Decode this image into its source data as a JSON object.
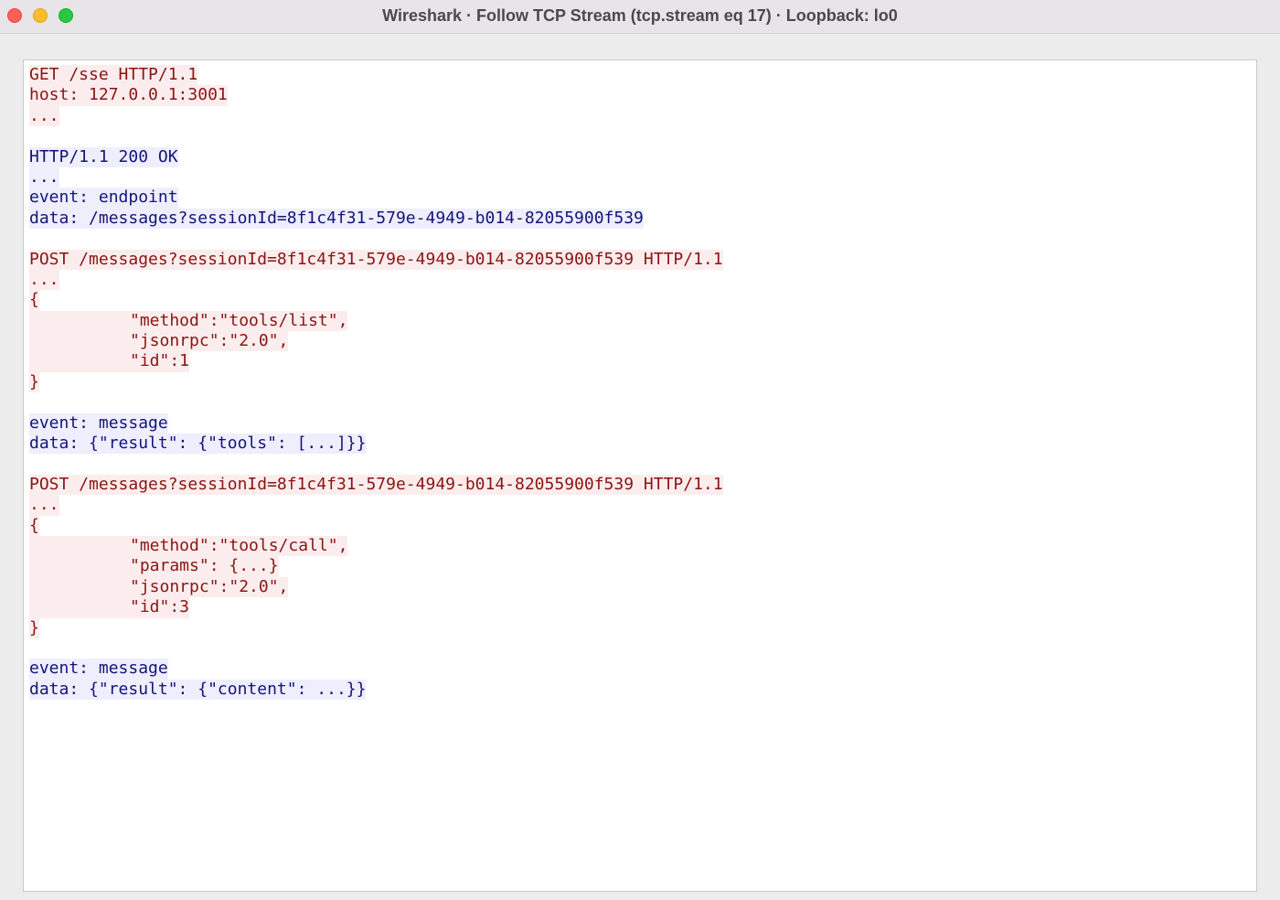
{
  "window": {
    "title": "Wireshark · Follow TCP Stream (tcp.stream eq 17) · Loopback: lo0"
  },
  "colors": {
    "client_text": "#8b1414",
    "client_bg": "#fbeded",
    "server_text": "#14147a",
    "server_bg": "#eeeefd"
  },
  "stream": {
    "lines": [
      {
        "side": "client",
        "indent": false,
        "text": "GET /sse HTTP/1.1"
      },
      {
        "side": "client",
        "indent": false,
        "text": "host: 127.0.0.1:3001"
      },
      {
        "side": "client",
        "indent": false,
        "text": "..."
      },
      {
        "side": "blank",
        "indent": false,
        "text": ""
      },
      {
        "side": "server",
        "indent": false,
        "text": "HTTP/1.1 200 OK"
      },
      {
        "side": "server",
        "indent": false,
        "text": "..."
      },
      {
        "side": "server",
        "indent": false,
        "text": "event: endpoint"
      },
      {
        "side": "server",
        "indent": false,
        "text": "data: /messages?sessionId=8f1c4f31-579e-4949-b014-82055900f539"
      },
      {
        "side": "blank",
        "indent": false,
        "text": ""
      },
      {
        "side": "client",
        "indent": false,
        "text": "POST /messages?sessionId=8f1c4f31-579e-4949-b014-82055900f539 HTTP/1.1"
      },
      {
        "side": "client",
        "indent": false,
        "text": "..."
      },
      {
        "side": "client",
        "indent": false,
        "text": "{"
      },
      {
        "side": "client",
        "indent": true,
        "text": "\"method\":\"tools/list\","
      },
      {
        "side": "client",
        "indent": true,
        "text": "\"jsonrpc\":\"2.0\","
      },
      {
        "side": "client",
        "indent": true,
        "text": "\"id\":1"
      },
      {
        "side": "client",
        "indent": false,
        "text": "}"
      },
      {
        "side": "blank",
        "indent": false,
        "text": ""
      },
      {
        "side": "server",
        "indent": false,
        "text": "event: message"
      },
      {
        "side": "server",
        "indent": false,
        "text": "data: {\"result\": {\"tools\": [...]}}"
      },
      {
        "side": "blank",
        "indent": false,
        "text": ""
      },
      {
        "side": "client",
        "indent": false,
        "text": "POST /messages?sessionId=8f1c4f31-579e-4949-b014-82055900f539 HTTP/1.1"
      },
      {
        "side": "client",
        "indent": false,
        "text": "..."
      },
      {
        "side": "client",
        "indent": false,
        "text": "{"
      },
      {
        "side": "client",
        "indent": true,
        "text": "\"method\":\"tools/call\","
      },
      {
        "side": "client",
        "indent": true,
        "text": "\"params\": {...}"
      },
      {
        "side": "client",
        "indent": true,
        "text": "\"jsonrpc\":\"2.0\","
      },
      {
        "side": "client",
        "indent": true,
        "text": "\"id\":3"
      },
      {
        "side": "client",
        "indent": false,
        "text": "}"
      },
      {
        "side": "blank",
        "indent": false,
        "text": ""
      },
      {
        "side": "server",
        "indent": false,
        "text": "event: message"
      },
      {
        "side": "server",
        "indent": false,
        "text": "data: {\"result\": {\"content\": ...}}"
      }
    ]
  }
}
